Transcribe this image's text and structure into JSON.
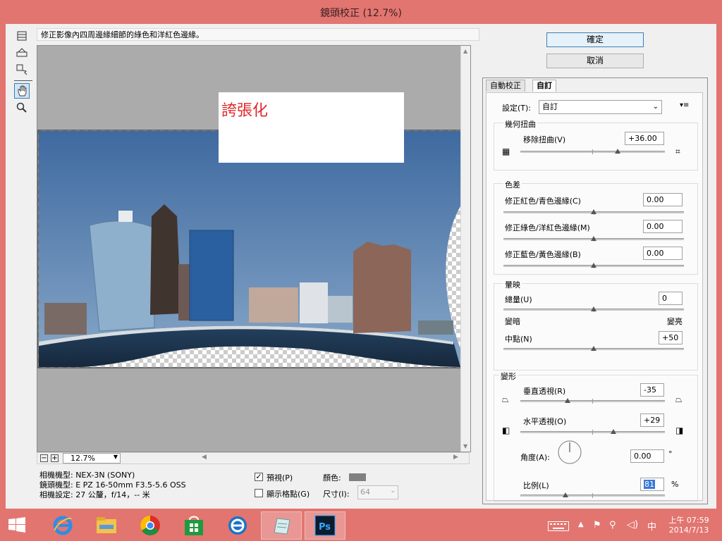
{
  "window": {
    "title": "鏡頭校正 (12.7%)"
  },
  "hint": "修正影像內四周邊緣細節的綠色和洋紅色邊緣。",
  "preview": {
    "overlay_text": "誇張化",
    "overlay_color": "#e0282a",
    "zoom": "12.7%"
  },
  "buttons": {
    "ok": "確定",
    "cancel": "取消"
  },
  "tabs": [
    "自動校正",
    "自訂"
  ],
  "settings": {
    "label": "設定(T):",
    "value": "自訂"
  },
  "geometric": {
    "title": "幾何扭曲",
    "remove_distortion": {
      "label": "移除扭曲(V)",
      "value": "+36.00"
    }
  },
  "chromatic": {
    "title": "色差",
    "red_cyan": {
      "label": "修正紅色/青色邊緣(C)",
      "value": "0.00"
    },
    "green_magenta": {
      "label": "修正綠色/洋紅色邊緣(M)",
      "value": "0.00"
    },
    "blue_yellow": {
      "label": "修正藍色/黃色邊緣(B)",
      "value": "0.00"
    }
  },
  "vignette": {
    "title": "暈映",
    "amount": {
      "label": "總量(U)",
      "value": "0"
    },
    "darken": "變暗",
    "lighten": "變亮",
    "midpoint": {
      "label": "中點(N)",
      "value": "+50"
    }
  },
  "transform": {
    "title": "變形",
    "vertical": {
      "label": "垂直透視(R)",
      "value": "-35"
    },
    "horizontal": {
      "label": "水平透視(O)",
      "value": "+29"
    },
    "angle": {
      "label": "角度(A):",
      "value": "0.00",
      "unit": "°"
    },
    "scale": {
      "label": "比例(L)",
      "value": "81",
      "unit": "%"
    }
  },
  "camera_info": {
    "model": "相機機型: NEX-3N (SONY)",
    "lens": "鏡頭機型: E PZ 16-50mm F3.5-5.6 OSS",
    "settings": "相機設定: 27 公釐，f/14，-- 米"
  },
  "grid_options": {
    "preview": "預視(P)",
    "show_grid": "顯示格點(G)",
    "color": "顏色:",
    "size": "尺寸(I):",
    "size_value": "64"
  },
  "taskbar": {
    "time": "上午 07:59",
    "date": "2014/7/13",
    "ime": "中"
  }
}
